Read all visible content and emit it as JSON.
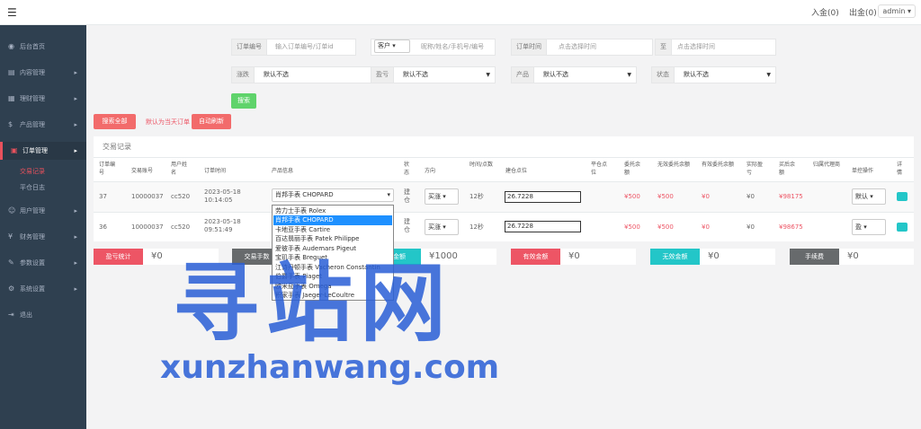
{
  "topbar": {
    "deposit": "入金(0)",
    "withdraw": "出金(0)",
    "admin": "admin"
  },
  "sidebar": {
    "items": [
      {
        "label": "后台首页",
        "icon": "dashboard-icon"
      },
      {
        "label": "内容管理",
        "icon": "content-icon"
      },
      {
        "label": "理财管理",
        "icon": "finance-icon"
      },
      {
        "label": "产品管理",
        "icon": "product-icon"
      },
      {
        "label": "订单管理",
        "icon": "order-icon"
      },
      {
        "label": "用户管理",
        "icon": "user-icon"
      },
      {
        "label": "财务管理",
        "icon": "money-icon"
      },
      {
        "label": "参数设置",
        "icon": "params-icon"
      },
      {
        "label": "系统设置",
        "icon": "settings-icon"
      },
      {
        "label": "退出",
        "icon": "logout-icon"
      }
    ],
    "sub": [
      "交易记录",
      "平仓日志"
    ]
  },
  "filters": {
    "order_no_label": "订单编号",
    "order_no_ph": "输入订单编号/订单id",
    "customer_sel": "客户",
    "customer_ph": "昵称/姓名/手机号/编号",
    "time_label": "订单时间",
    "time_from_ph": "点击选择时间",
    "to_label": "至",
    "time_to_ph": "点击选择时间",
    "rise_fall_label": "涨跌",
    "rise_fall_val": "默认不选",
    "pnl_label": "盈亏",
    "pnl_val": "默认不选",
    "product_label": "产品",
    "product_val": "默认不选",
    "status_label": "状态",
    "status_val": "默认不选",
    "search_btn": "搜索"
  },
  "actions": {
    "search_all": "搜索全部",
    "today_label": "默认为当天订单",
    "auto_refresh": "自动刷新"
  },
  "table": {
    "title": "交易记录",
    "headers": [
      "订单编号",
      "交易账号",
      "用户姓名",
      "订单时间",
      "产品信息",
      "状态",
      "方向",
      "时间/点数",
      "建仓点位",
      "平仓点位",
      "委托余额",
      "无效委托余额",
      "有效委托余额",
      "实际盈亏",
      "买后余额",
      "归属代理商",
      "单控操作",
      "详情"
    ],
    "rows": [
      {
        "id": "37",
        "account": "10000037",
        "name": "cc520",
        "time": "2023-05-18 10:14:05",
        "product": "肖邦手表 CHOPARD",
        "status": "建仓",
        "dir": "买涨",
        "seconds": "12秒",
        "open": "26.7228",
        "entrust": "¥500",
        "invalid": "¥500",
        "valid": "¥0",
        "pnl": "¥0",
        "after": "¥98175",
        "ctrl": "默认"
      },
      {
        "id": "36",
        "account": "10000037",
        "name": "cc520",
        "time": "2023-05-18 09:51:49",
        "product": "",
        "status": "建仓",
        "dir": "买涨",
        "seconds": "12秒",
        "open": "26.7228",
        "entrust": "¥500",
        "invalid": "¥500",
        "valid": "¥0",
        "pnl": "¥0",
        "after": "¥98675",
        "ctrl": "盈"
      }
    ]
  },
  "dropdown": [
    "劳力士手表 Rolex",
    "肖邦手表 CHOPARD",
    "卡地亚手表 Cartire",
    "百达翡丽手表 Patek Philippe",
    "爱彼手表 Audemars Pigeut",
    "宝玑手表 Breguet",
    "江诗丹顿手表 Vacheron Constantin",
    "伯爵手表 Piaget",
    "欧米茄手表 Omega",
    "积家手表 Jaeger-LeCoultre"
  ],
  "stats": [
    {
      "label": "盈亏统计",
      "value": "¥0",
      "color": "#ed5565"
    },
    {
      "label": "交易手数",
      "value": "",
      "color": "#676a6c"
    },
    {
      "label": "总金额",
      "value": "¥1000",
      "color": "#23c6c8"
    },
    {
      "label": "有效金额",
      "value": "¥0",
      "color": "#ed5565"
    },
    {
      "label": "无效金额",
      "value": "¥0",
      "color": "#23c6c8"
    },
    {
      "label": "手续费",
      "value": "¥0",
      "color": "#676a6c"
    }
  ],
  "watermark": {
    "cn": "寻站网",
    "en": "xunzhanwang.com"
  }
}
